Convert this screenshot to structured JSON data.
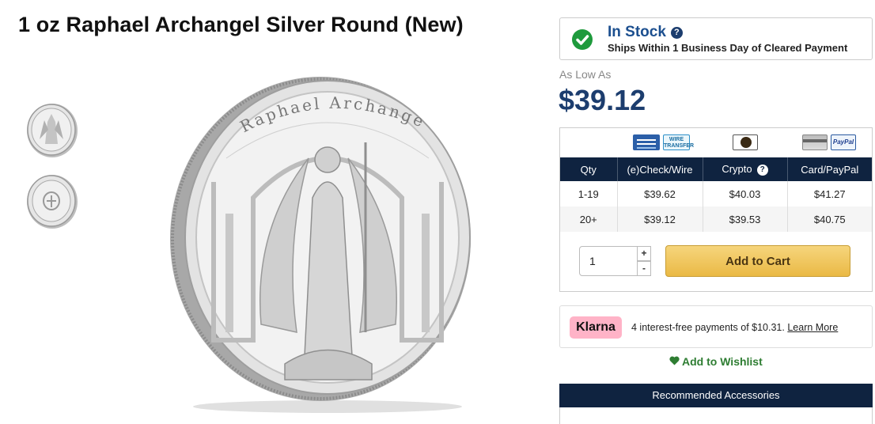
{
  "product": {
    "title": "1 oz Raphael Archangel Silver Round (New)",
    "coin_legend": "Raphael Archangel"
  },
  "gallery": {
    "thumbnails": [
      "coin-obverse-thumbnail",
      "coin-reverse-thumbnail"
    ]
  },
  "stock": {
    "status": "In Stock",
    "ships": "Ships Within 1 Business Day of Cleared Payment",
    "status_color": "#1c4f8f",
    "check_color": "#1e9a3c",
    "help_glyph": "?"
  },
  "pricing": {
    "as_low_as_label": "As Low As",
    "as_low_as_price": "$39.12",
    "payment_icons": [
      "echeck-icon",
      "wire-transfer-icon",
      "crypto-icon",
      "credit-card-icon",
      "paypal-icon"
    ],
    "wire_icon_text": "WIRE TRANSFER",
    "paypal_icon_text": "PayPal",
    "columns": [
      "Qty",
      "(e)Check/Wire",
      "Crypto",
      "Card/PayPal"
    ],
    "rows": [
      {
        "qty": "1-19",
        "check": "$39.62",
        "crypto": "$40.03",
        "card": "$41.27"
      },
      {
        "qty": "20+",
        "check": "$39.12",
        "crypto": "$39.53",
        "card": "$40.75"
      }
    ]
  },
  "cart": {
    "quantity": "1",
    "plus": "+",
    "minus": "-",
    "add_to_cart": "Add to Cart",
    "button_color": "#eab945"
  },
  "klarna": {
    "logo_text": "Klarna",
    "message": "4 interest-free payments of $10.31.",
    "link": "Learn More",
    "brand_color": "#ffb3c7"
  },
  "wishlist": {
    "label": "Add to Wishlist",
    "color": "#2e7d32"
  },
  "accessories": {
    "header": "Recommended Accessories"
  }
}
